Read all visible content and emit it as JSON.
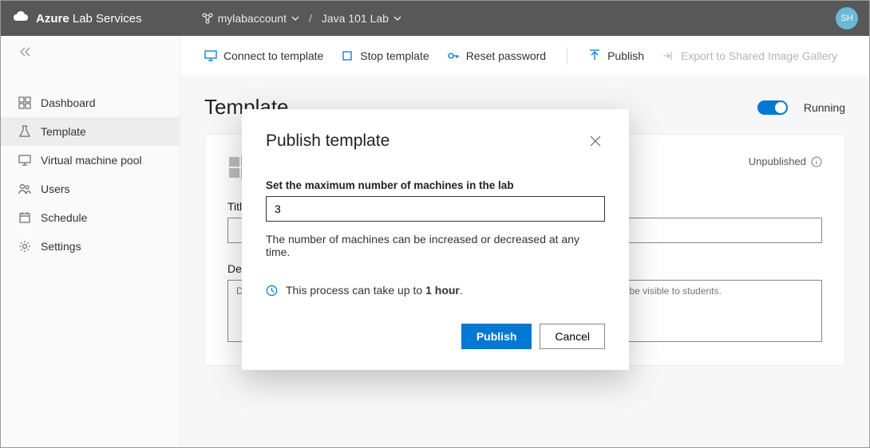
{
  "header": {
    "brand_bold": "Azure",
    "brand_rest": "Lab Services",
    "account_label": "mylabaccount",
    "lab_label": "Java 101 Lab",
    "avatar_initials": "SH"
  },
  "sidebar": {
    "items": [
      {
        "label": "Dashboard"
      },
      {
        "label": "Template"
      },
      {
        "label": "Virtual machine pool"
      },
      {
        "label": "Users"
      },
      {
        "label": "Schedule"
      },
      {
        "label": "Settings"
      }
    ],
    "active_index": 1
  },
  "toolbar": {
    "connect": "Connect to template",
    "stop": "Stop template",
    "reset": "Reset password",
    "publish": "Publish",
    "export": "Export to Shared Image Gallery"
  },
  "page": {
    "title": "Template",
    "running_label": "Running",
    "status": "Unpublished",
    "title_field_label": "Title",
    "desc_field_label": "Description",
    "desc_placeholder": "Describe this lab (e.g., This lab is an introduction to Java programming). This description will be visible to students."
  },
  "modal": {
    "title": "Publish template",
    "max_label": "Set the maximum number of machines in the lab",
    "max_value": "3",
    "hint": "The number of machines can be increased or decreased at any time.",
    "info_prefix": "This process can take up to ",
    "info_bold": "1 hour",
    "info_suffix": ".",
    "publish_btn": "Publish",
    "cancel_btn": "Cancel"
  }
}
